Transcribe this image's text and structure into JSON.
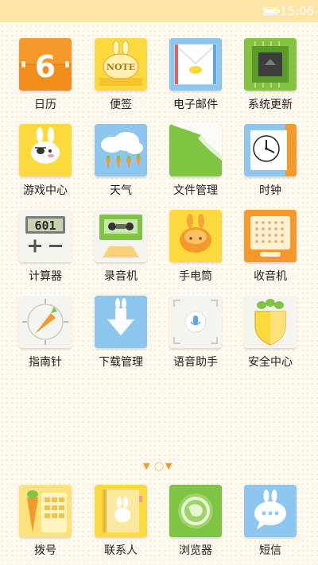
{
  "status_bar": {
    "time": "15:06"
  },
  "apps": [
    {
      "label": "日历",
      "icon": "calendar-icon"
    },
    {
      "label": "便签",
      "icon": "note-icon"
    },
    {
      "label": "电子邮件",
      "icon": "email-icon"
    },
    {
      "label": "系统更新",
      "icon": "chip-icon"
    },
    {
      "label": "游戏中心",
      "icon": "game-center-icon"
    },
    {
      "label": "天气",
      "icon": "weather-icon"
    },
    {
      "label": "文件管理",
      "icon": "file-manager-icon"
    },
    {
      "label": "时钟",
      "icon": "clock-icon"
    },
    {
      "label": "计算器",
      "icon": "calculator-icon"
    },
    {
      "label": "录音机",
      "icon": "recorder-icon"
    },
    {
      "label": "手电筒",
      "icon": "flashlight-icon"
    },
    {
      "label": "收音机",
      "icon": "radio-icon"
    },
    {
      "label": "指南针",
      "icon": "compass-icon"
    },
    {
      "label": "下载管理",
      "icon": "download-icon"
    },
    {
      "label": "语音助手",
      "icon": "microphone-icon"
    },
    {
      "label": "安全中心",
      "icon": "shield-icon"
    }
  ],
  "calendar_day": "6",
  "calculator_display": "601",
  "note_text": "NOTE",
  "dock": [
    {
      "label": "拨号",
      "icon": "dialer-icon"
    },
    {
      "label": "联系人",
      "icon": "contacts-icon"
    },
    {
      "label": "浏览器",
      "icon": "browser-icon"
    },
    {
      "label": "短信",
      "icon": "messages-icon"
    }
  ],
  "colors": {
    "status_bar": "#fbe6a6",
    "background": "#fdf9ee",
    "orange": "#f49a2a",
    "yellow": "#fbd83a",
    "blue": "#8cc8f2",
    "green": "#7ec544"
  }
}
